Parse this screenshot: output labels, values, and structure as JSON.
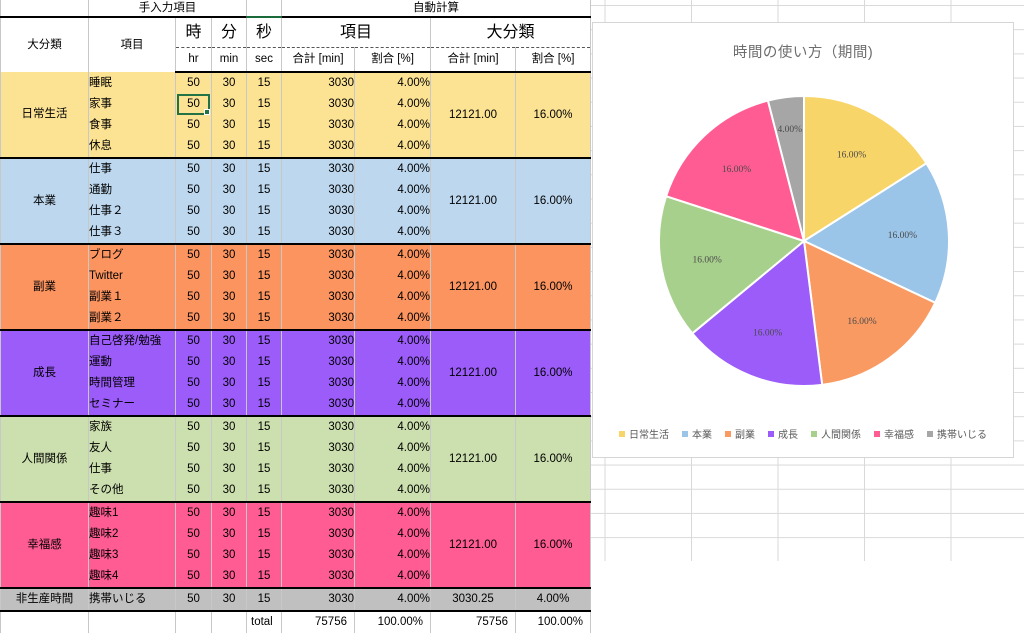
{
  "banner": {
    "manual_label": "手入力項目",
    "auto_label": "自動計算"
  },
  "table": {
    "headers": {
      "cat": "大分類",
      "item": "項目",
      "hr_jp": "時",
      "min_jp": "分",
      "sec_jp": "秒",
      "hr": "hr",
      "min": "min",
      "sec": "sec",
      "group_item": "項目",
      "group_cat": "大分類",
      "sum_min_1": "合計 [min]",
      "ratio_1": "割合 [%]",
      "sum_min_2": "合計 [min]",
      "ratio_2": "割合 [%]"
    },
    "groups": [
      {
        "name": "日常生活",
        "color": "#FCE394",
        "cat_sum": "12121.00",
        "cat_ratio": "16.00%",
        "rows": [
          {
            "item": "睡眠",
            "hr": "50",
            "min": "30",
            "sec": "15",
            "sum": "3030",
            "ratio": "4.00%"
          },
          {
            "item": "家事",
            "hr": "50",
            "min": "30",
            "sec": "15",
            "sum": "3030",
            "ratio": "4.00%",
            "selected": true
          },
          {
            "item": "食事",
            "hr": "50",
            "min": "30",
            "sec": "15",
            "sum": "3030",
            "ratio": "4.00%"
          },
          {
            "item": "休息",
            "hr": "50",
            "min": "30",
            "sec": "15",
            "sum": "3030",
            "ratio": "4.00%"
          }
        ]
      },
      {
        "name": "本業",
        "color": "#BDD7EE",
        "cat_sum": "12121.00",
        "cat_ratio": "16.00%",
        "rows": [
          {
            "item": "仕事",
            "hr": "50",
            "min": "30",
            "sec": "15",
            "sum": "3030",
            "ratio": "4.00%"
          },
          {
            "item": "通勤",
            "hr": "50",
            "min": "30",
            "sec": "15",
            "sum": "3030",
            "ratio": "4.00%"
          },
          {
            "item": "仕事２",
            "hr": "50",
            "min": "30",
            "sec": "15",
            "sum": "3030",
            "ratio": "4.00%"
          },
          {
            "item": "仕事３",
            "hr": "50",
            "min": "30",
            "sec": "15",
            "sum": "3030",
            "ratio": "4.00%"
          }
        ]
      },
      {
        "name": "副業",
        "color": "#FC9460",
        "cat_sum": "12121.00",
        "cat_ratio": "16.00%",
        "rows": [
          {
            "item": "ブログ",
            "hr": "50",
            "min": "30",
            "sec": "15",
            "sum": "3030",
            "ratio": "4.00%"
          },
          {
            "item": "Twitter",
            "hr": "50",
            "min": "30",
            "sec": "15",
            "sum": "3030",
            "ratio": "4.00%"
          },
          {
            "item": "副業１",
            "hr": "50",
            "min": "30",
            "sec": "15",
            "sum": "3030",
            "ratio": "4.00%"
          },
          {
            "item": "副業２",
            "hr": "50",
            "min": "30",
            "sec": "15",
            "sum": "3030",
            "ratio": "4.00%"
          }
        ]
      },
      {
        "name": "成長",
        "color": "#9B5CFA",
        "cat_sum": "12121.00",
        "cat_ratio": "16.00%",
        "rows": [
          {
            "item": "自己啓発/勉強",
            "hr": "50",
            "min": "30",
            "sec": "15",
            "sum": "3030",
            "ratio": "4.00%"
          },
          {
            "item": "運動",
            "hr": "50",
            "min": "30",
            "sec": "15",
            "sum": "3030",
            "ratio": "4.00%"
          },
          {
            "item": "時間管理",
            "hr": "50",
            "min": "30",
            "sec": "15",
            "sum": "3030",
            "ratio": "4.00%"
          },
          {
            "item": "セミナー",
            "hr": "50",
            "min": "30",
            "sec": "15",
            "sum": "3030",
            "ratio": "4.00%"
          }
        ]
      },
      {
        "name": "人間関係",
        "color": "#CCDFAE",
        "cat_sum": "12121.00",
        "cat_ratio": "16.00%",
        "rows": [
          {
            "item": "家族",
            "hr": "50",
            "min": "30",
            "sec": "15",
            "sum": "3030",
            "ratio": "4.00%"
          },
          {
            "item": "友人",
            "hr": "50",
            "min": "30",
            "sec": "15",
            "sum": "3030",
            "ratio": "4.00%"
          },
          {
            "item": "仕事",
            "hr": "50",
            "min": "30",
            "sec": "15",
            "sum": "3030",
            "ratio": "4.00%"
          },
          {
            "item": "その他",
            "hr": "50",
            "min": "30",
            "sec": "15",
            "sum": "3030",
            "ratio": "4.00%"
          }
        ]
      },
      {
        "name": "幸福感",
        "color": "#FF5C93",
        "cat_sum": "12121.00",
        "cat_ratio": "16.00%",
        "rows": [
          {
            "item": "趣味1",
            "hr": "50",
            "min": "30",
            "sec": "15",
            "sum": "3030",
            "ratio": "4.00%"
          },
          {
            "item": "趣味2",
            "hr": "50",
            "min": "30",
            "sec": "15",
            "sum": "3030",
            "ratio": "4.00%"
          },
          {
            "item": "趣味3",
            "hr": "50",
            "min": "30",
            "sec": "15",
            "sum": "3030",
            "ratio": "4.00%"
          },
          {
            "item": "趣味4",
            "hr": "50",
            "min": "30",
            "sec": "15",
            "sum": "3030",
            "ratio": "4.00%"
          }
        ]
      },
      {
        "name": "非生産時間",
        "color": "#C0C0C0",
        "cat_sum": "3030.25",
        "cat_ratio": "4.00%",
        "rows": [
          {
            "item": "携帯いじる",
            "hr": "50",
            "min": "30",
            "sec": "15",
            "sum": "3030",
            "ratio": "4.00%"
          }
        ]
      }
    ],
    "total": {
      "label": "total",
      "sum_1": "75756",
      "ratio_1": "100.00%",
      "sum_2": "75756",
      "ratio_2": "100.00%"
    }
  },
  "chart_data": {
    "type": "pie",
    "title": "時間の使い方（期間)",
    "categories": [
      "日常生活",
      "本業",
      "副業",
      "成長",
      "人間関係",
      "幸福感",
      "携帯いじる"
    ],
    "values": [
      16.0,
      16.0,
      16.0,
      16.0,
      16.0,
      16.0,
      4.0
    ],
    "labels": [
      "16.00%",
      "16.00%",
      "16.00%",
      "16.00%",
      "16.00%",
      "16.00%",
      "4.00%"
    ],
    "colors": [
      "#F8D568",
      "#9AC4E8",
      "#FA9A63",
      "#9B5CFA",
      "#A8D08D",
      "#FF5C93",
      "#A6A6A6"
    ],
    "legend_position": "bottom",
    "legend": [
      "日常生活",
      "本業",
      "副業",
      "成長",
      "人間関係",
      "幸福感",
      "携帯いじる"
    ],
    "units": "percent",
    "start_angle_deg": -90,
    "direction": "clockwise"
  }
}
